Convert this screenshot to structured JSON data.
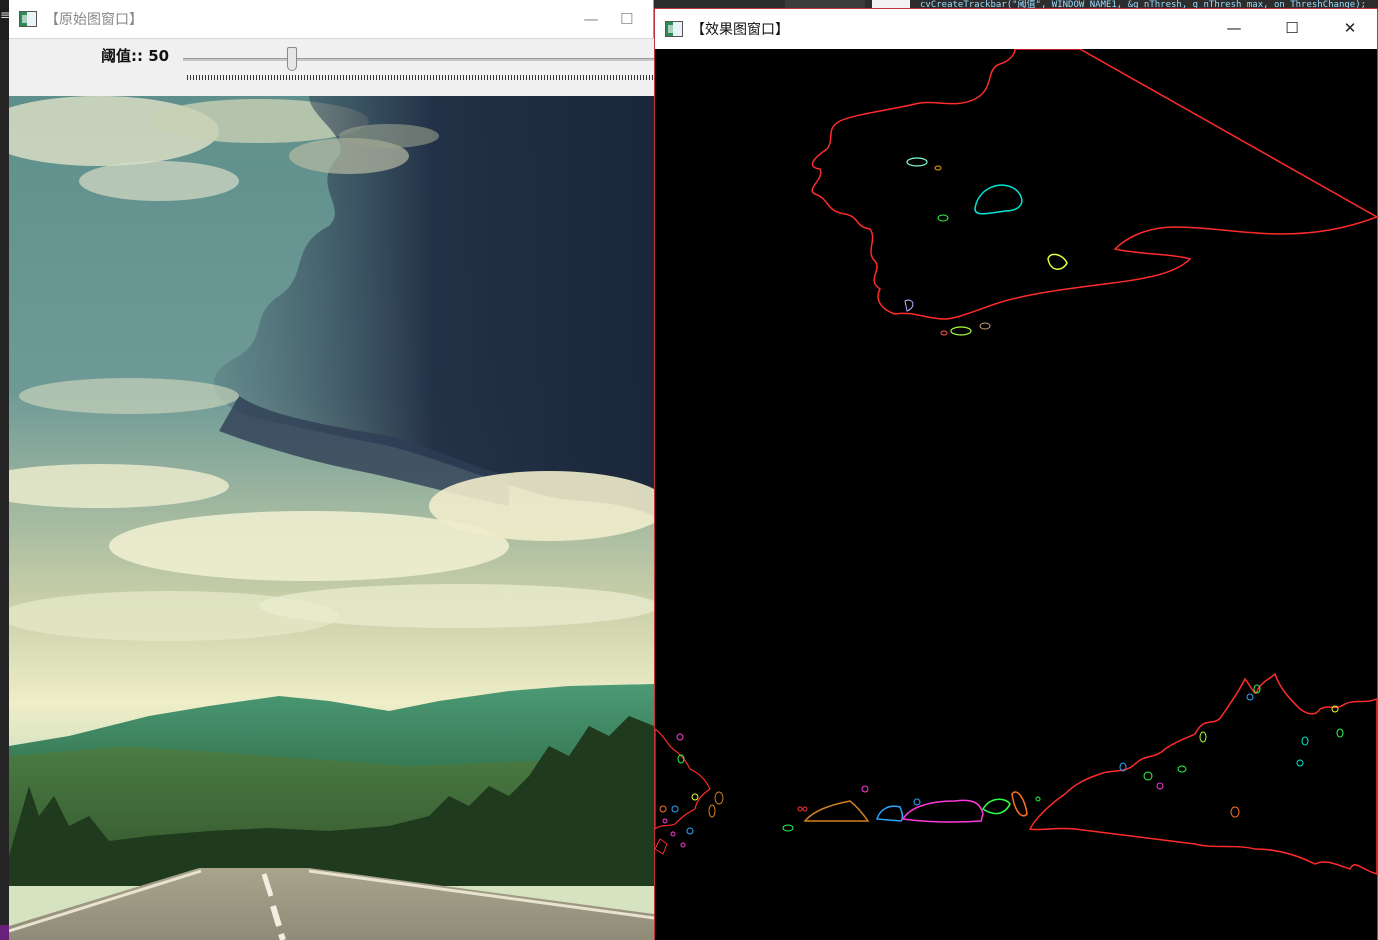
{
  "background_editor": {
    "code_snippet": "cvCreateTrackbar(\"阈值\", WINDOW_NAME1, &g_nThresh, g_nThresh_max, on_ThreshChange);"
  },
  "original_window": {
    "title": "【原始图窗口】",
    "controls": {
      "minimize": "—",
      "maximize": "☐"
    },
    "trackbar": {
      "label": "阈值:: 50",
      "value": 50,
      "min": 0,
      "max": 255
    },
    "image_description_icon": "landscape-road-photo"
  },
  "result_window": {
    "title": "【效果图窗口】",
    "controls": {
      "minimize": "—",
      "maximize": "☐",
      "close": "✕"
    }
  },
  "colors": {
    "result_border": "#c1343c",
    "contour_main": "#ff2b2b",
    "contour_cyan": "#00e5d4",
    "contour_yellow": "#e8ff3a",
    "contour_green": "#2dff4a",
    "contour_magenta": "#ff3ad8",
    "contour_orange": "#d08020",
    "contour_blue": "#2aa8ff"
  }
}
